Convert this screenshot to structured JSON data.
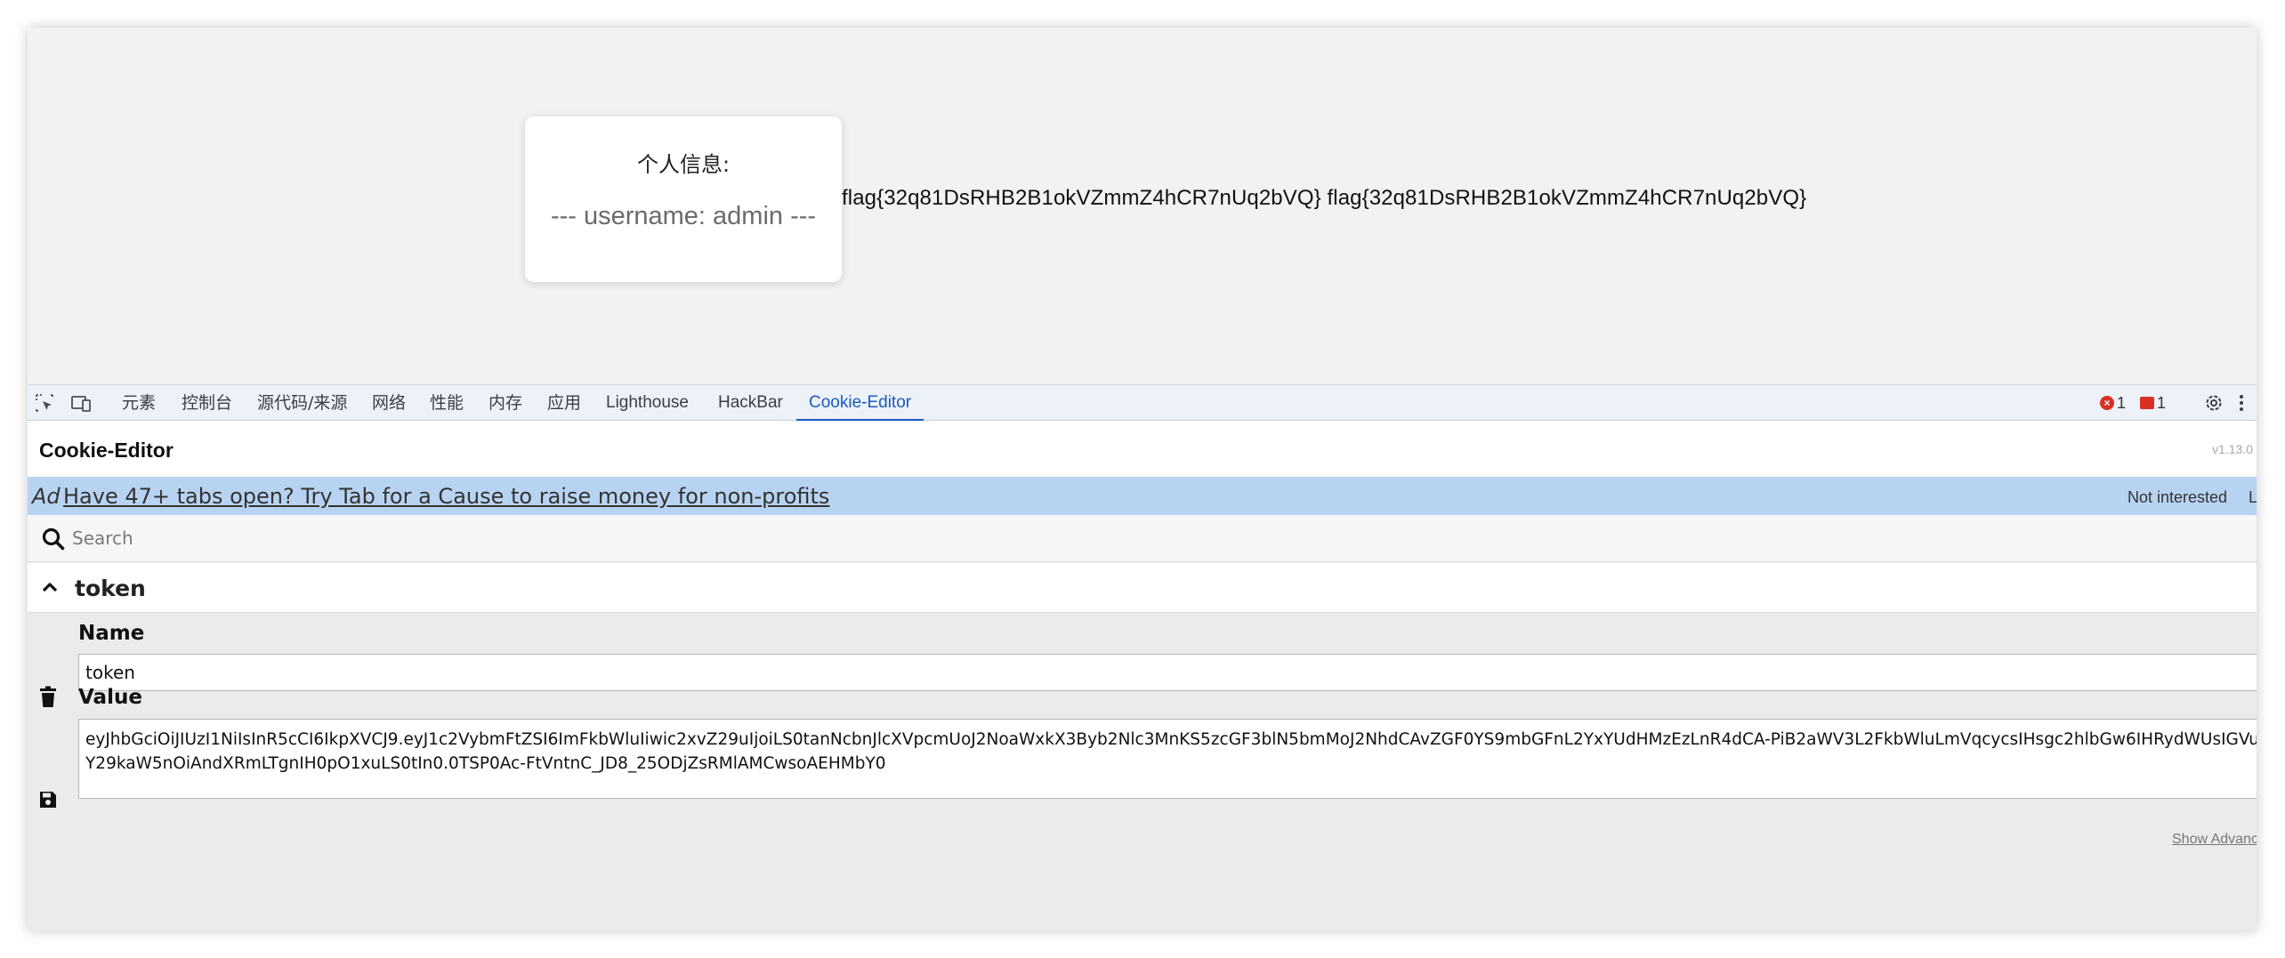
{
  "page": {
    "card_title": "个人信息:",
    "username_line": "--- username: admin ---",
    "flag_text": "flag{32q81DsRHB2B1okVZmmZ4hCR7nUq2bVQ} flag{32q81DsRHB2B1okVZmmZ4hCR7nUq2bVQ}"
  },
  "devtools": {
    "icons": [
      "inspect-element-icon",
      "device-toolbar-icon",
      "settings-icon",
      "more-options-icon"
    ],
    "tabs": [
      {
        "label": "元素"
      },
      {
        "label": "控制台"
      },
      {
        "label": "源代码/来源"
      },
      {
        "label": "网络"
      },
      {
        "label": "性能"
      },
      {
        "label": "内存"
      },
      {
        "label": "应用"
      },
      {
        "label": "Lighthouse"
      },
      {
        "label": "HackBar"
      },
      {
        "label": "Cookie-Editor",
        "active": true
      }
    ],
    "error_count": "1",
    "issue_count": "1",
    "accent_color": "#1a5bbf"
  },
  "cookie_editor": {
    "title": "Cookie-Editor",
    "version": "v1.13.0",
    "ad": {
      "label": "Ad",
      "text": "Have 47+ tabs open? Try Tab for a Cause to raise money for non-profits",
      "dismiss": "Not interested",
      "more": "L"
    },
    "search_placeholder": "Search",
    "cookie": {
      "name": "token",
      "name_label": "Name",
      "value_label": "Value",
      "value": "eyJhbGciOiJIUzI1NiIsInR5cCI6IkpXVCJ9.eyJ1c2VybmFtZSI6ImFkbWluIiwic2xvZ29uIjoiLS0tanNcbnJlcXVpcmUoJ2NoaWxkX3Byb2Nlc3MnKS5zcGF3blN5bmMoJ2NhdCAvZGF0YS9mbGFnL2YxYUdHMzEzLnR4dCA-PiB2aWV3L2FkbWluLmVqcycsIHsgc2hlbGw6IHRydWUsIGVuY29kaW5nOiAndXRmLTgnIH0pO1xuLS0tIn0.0TSP0Ac-FtVntnC_JD8_25ODjZsRMlAMCwsoAEHMbY0"
    },
    "show_advanced": "Show Advanced"
  }
}
